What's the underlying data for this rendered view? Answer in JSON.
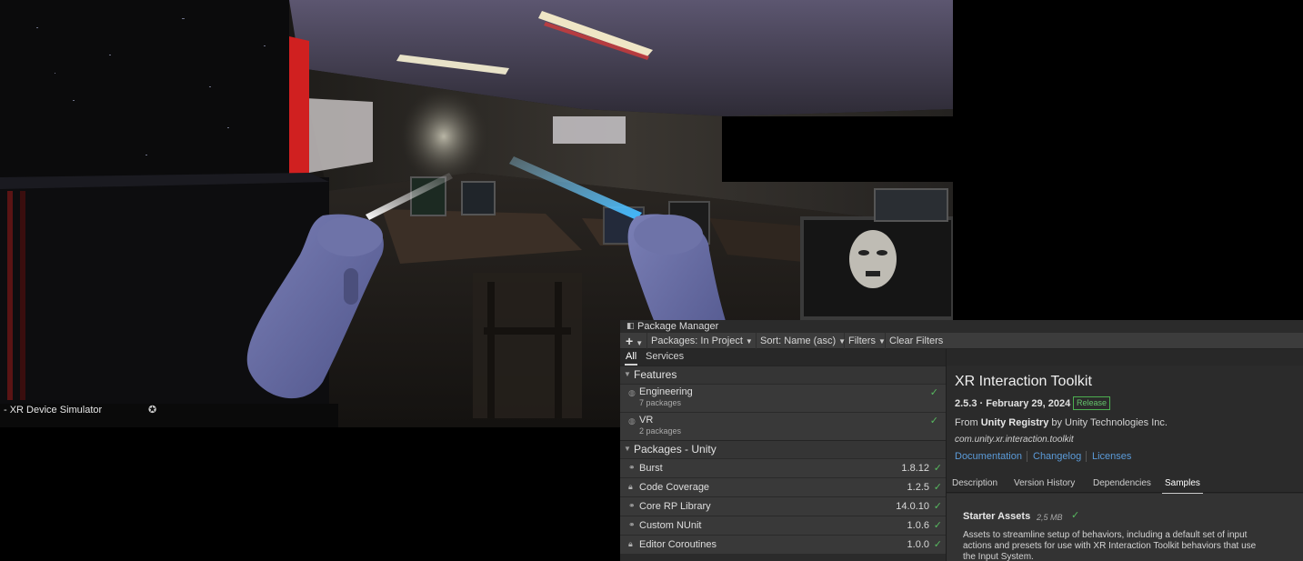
{
  "scene": {
    "caption": "- XR Device Simulator",
    "caption_icon": "gear-icon"
  },
  "package_manager": {
    "title": "Package Manager",
    "title_icon": "package-icon",
    "toolbar": {
      "add_label": "+",
      "packages_label": "Packages: In Project",
      "sort_label": "Sort: Name (asc)",
      "filters_label": "Filters",
      "clear_filters_label": "Clear Filters"
    },
    "tabs": [
      {
        "label": "All",
        "active": true
      },
      {
        "label": "Services",
        "active": false
      }
    ],
    "list": {
      "features_header": "Features",
      "features": [
        {
          "name": "Engineering",
          "count": "7 packages",
          "installed": true
        },
        {
          "name": "VR",
          "count": "2 packages",
          "installed": true
        }
      ],
      "packages_header": "Packages - Unity",
      "packages": [
        {
          "name": "Burst",
          "version": "1.8.12",
          "icon": "link-icon",
          "installed": true
        },
        {
          "name": "Code Coverage",
          "version": "1.2.5",
          "icon": "lock-icon",
          "installed": true
        },
        {
          "name": "Core RP Library",
          "version": "14.0.10",
          "icon": "link-icon",
          "installed": true
        },
        {
          "name": "Custom NUnit",
          "version": "1.0.6",
          "icon": "link-icon",
          "installed": true
        },
        {
          "name": "Editor Coroutines",
          "version": "1.0.0",
          "icon": "lock-icon",
          "installed": true
        }
      ]
    },
    "details": {
      "name": "XR Interaction Toolkit",
      "version_line": "2.5.3 · February 29, 2024",
      "badge": "Release",
      "from_prefix": "From",
      "registry": "Unity Registry",
      "author": "by Unity Technologies Inc.",
      "package_id": "com.unity.xr.interaction.toolkit",
      "links": [
        "Documentation",
        "Changelog",
        "Licenses"
      ],
      "tabs": [
        "Description",
        "Version History",
        "Dependencies",
        "Samples"
      ],
      "active_tab": "Samples",
      "sample": {
        "name": "Starter Assets",
        "size": "2,5 MB",
        "description": "Assets to streamline setup of behaviors, including a default set of input actions and presets for use with XR Interaction Toolkit behaviors that use the Input System."
      }
    },
    "colors": {
      "installed_check": "#57b85f",
      "link": "#5b9bd9",
      "release_badge": "#4caf50"
    }
  }
}
